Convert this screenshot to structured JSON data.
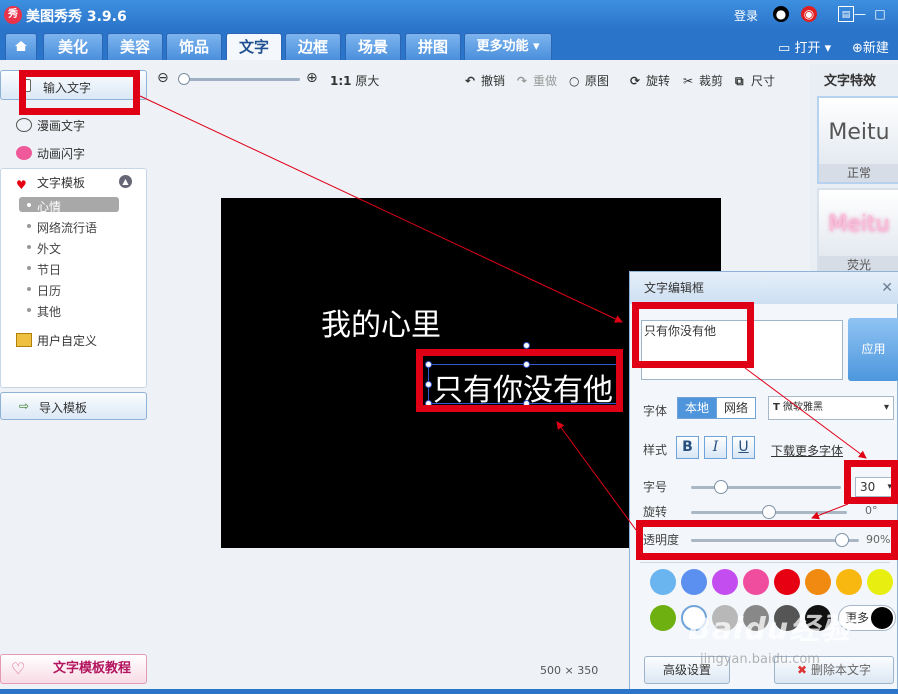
{
  "app": {
    "logo_text": "秀",
    "title": "美图秀秀 3.9.6",
    "login": "登录",
    "open": "打开",
    "new": "新建"
  },
  "tabs": [
    "美化",
    "美容",
    "饰品",
    "文字",
    "边框",
    "场景",
    "拼图",
    "更多功能"
  ],
  "toolbar": {
    "zoom_ratio": "1:1",
    "original_size": "原大",
    "undo": "撤销",
    "redo": "重做",
    "original": "原图",
    "rotate": "旋转",
    "crop": "裁剪",
    "size": "尺寸"
  },
  "left": {
    "input_text": "输入文字",
    "comic_text": "漫画文字",
    "anim_text": "动画闪字",
    "template": "文字模板",
    "subs": [
      "心情",
      "网络流行语",
      "外文",
      "节日",
      "日历",
      "其他"
    ],
    "custom": "用户自定义",
    "import": "导入模板",
    "tutorial": "文字模板教程"
  },
  "canvas": {
    "text1": "我的心里",
    "text2": "只有你没有他",
    "width": "500",
    "x": "×",
    "height": "350"
  },
  "effects": {
    "header": "文字特效",
    "items": [
      {
        "preview": "Meitu",
        "label": "正常"
      },
      {
        "preview": "Meitu",
        "label": "荧光"
      }
    ]
  },
  "dialog": {
    "title": "文字编辑框",
    "close": "✕",
    "text": "只有你没有他",
    "apply": "应用",
    "font_label": "字体",
    "local": "本地",
    "network": "网络",
    "font_value": "微软雅黑",
    "style_label": "样式",
    "bold": "B",
    "italic": "I",
    "underline": "U",
    "download_fonts": "下载更多字体",
    "size_label": "字号",
    "size_value": "30",
    "rotate_label": "旋转",
    "rotate_value": "0°",
    "opacity_label": "透明度",
    "opacity_value": "90%",
    "more_colors": "更多",
    "advanced": "高级设置",
    "delete": "删除本文字",
    "size_level": 0.2,
    "rotate_level": 0.5,
    "opacity_level": 0.9
  },
  "colors": [
    "#6ab4f0",
    "#5b8ff0",
    "#c44df0",
    "#f04d9e",
    "#e60012",
    "#f08a10",
    "#f8b810",
    "#e8ef10",
    "#6db010",
    "#ffffff",
    "#b8b8b8",
    "#888888",
    "#555555",
    "#111111"
  ],
  "watermark": {
    "main": "Baidu经验",
    "sub": "jingyan.baidu.com"
  }
}
